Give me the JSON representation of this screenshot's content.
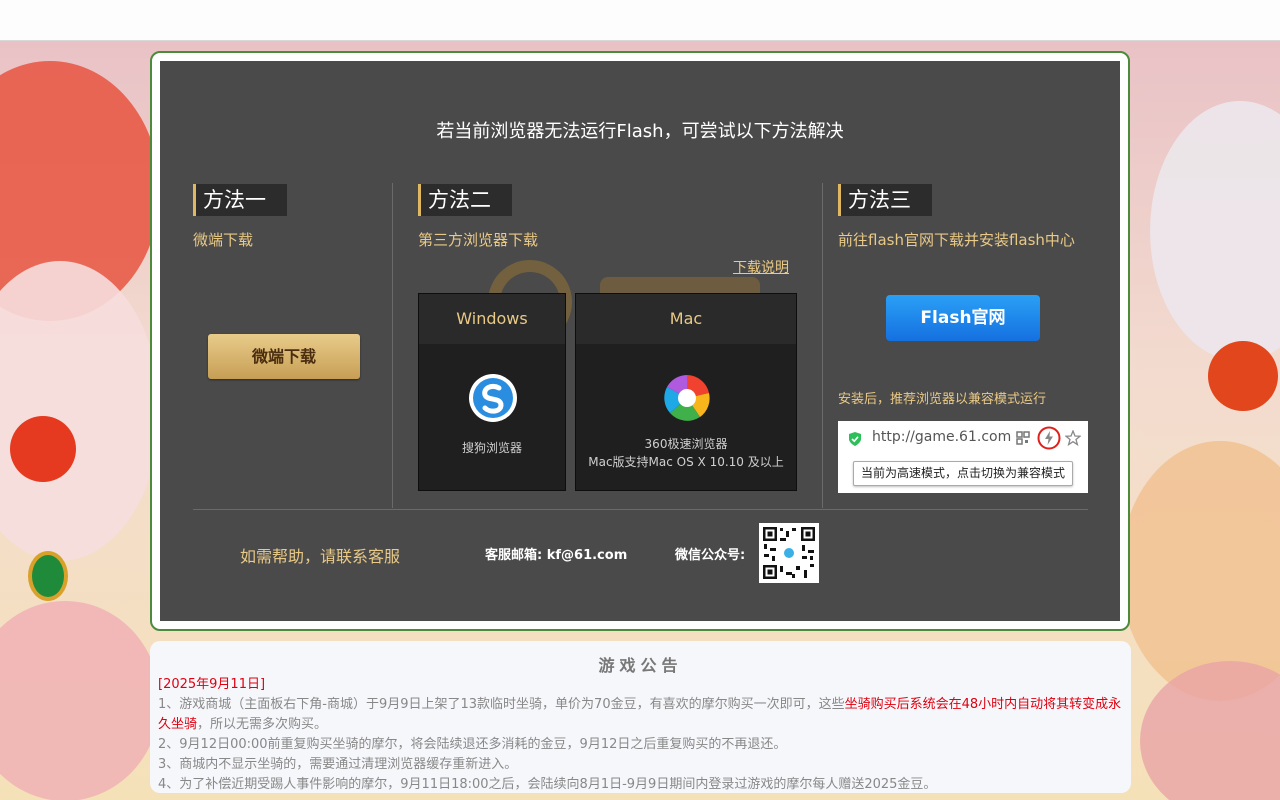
{
  "panel": {
    "title": "若当前浏览器无法运行Flash，可尝试以下方法解决",
    "method1": {
      "tag": "方法一",
      "sub": "微端下载",
      "button": "微端下载"
    },
    "method2": {
      "tag": "方法二",
      "sub": "第三方浏览器下载",
      "note_link": "下载说明",
      "windows": {
        "header": "Windows",
        "caption": "搜狗浏览器"
      },
      "mac": {
        "header": "Mac",
        "caption1": "360极速浏览器",
        "caption2": "Mac版支持Mac OS X 10.10 及以上"
      }
    },
    "method3": {
      "tag": "方法三",
      "sub": "前往flash官网下载并安装flash中心",
      "button": "Flash官网",
      "after_note": "安装后，推荐浏览器以兼容模式运行",
      "url": "http://game.61.com",
      "tooltip": "当前为高速模式，点击切换为兼容模式"
    },
    "footer": {
      "help": "如需帮助，请联系客服",
      "mail": "客服邮箱: kf@61.com",
      "wechat": "微信公众号:"
    }
  },
  "notice": {
    "title": "游戏公告",
    "date": "[2025年9月11日]",
    "line1_pre": "1、游戏商城（主面板右下角-商城）于9月9日上架了13款临时坐骑，单价为70金豆，有喜欢的摩尔购买一次即可，这些",
    "line1_red": "坐骑购买后系统会在48小时内自动将其转变成永久坐骑",
    "line1_post": "，所以无需多次购买。",
    "line2": "2、9月12日00:00前重复购买坐骑的摩尔，将会陆续退还多消耗的金豆，9月12日之后重复购买的不再退还。",
    "line3": "3、商城内不显示坐骑的，需要通过清理浏览器缓存重新进入。",
    "line4": "4、为了补偿近期受踢人事件影响的摩尔，9月11日18:00之后，会陆续向8月1日-9月9日期间内登录过游戏的摩尔每人赠送2025金豆。"
  },
  "colors": {
    "accent_gold": "#e9c986",
    "flash_blue": "#1e88ee",
    "panel_bg": "#4a4a4a",
    "notice_red": "#e0000f"
  }
}
